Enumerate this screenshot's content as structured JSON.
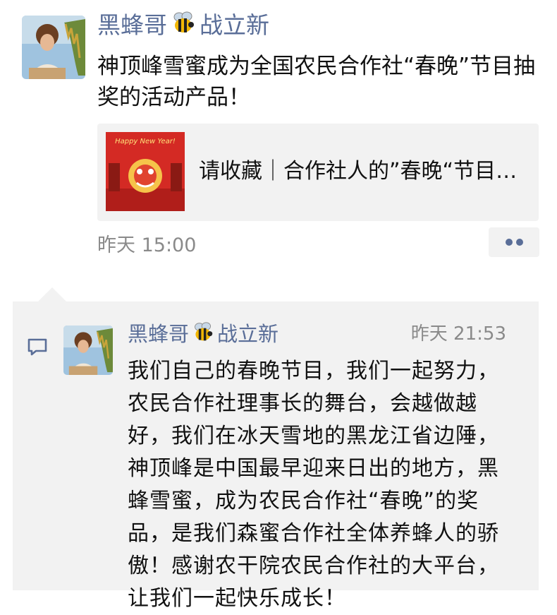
{
  "post": {
    "author": {
      "name": "黑蜂哥",
      "name_suffix": "战立新",
      "avatar_icon": "avatar-photo",
      "emoji_icon": "bee-icon"
    },
    "text": "神顶峰雪蜜成为全国农民合作社“春晚”节目抽奖的活动产品！",
    "shared_link": {
      "title": "请收藏｜合作社人的”春晚“节目…",
      "thumb_text": "Happy New Year!",
      "thumb_icon": "lion-dance-icon"
    },
    "time": "昨天 15:00",
    "more_icon": "more-dots-icon"
  },
  "comments": [
    {
      "name": "黑蜂哥",
      "name_suffix": "战立新",
      "time": "昨天 21:53",
      "text": "我们自己的春晚节目，我们一起努力，农民合作社理事长的舞台，会越做越好，我们在冰天雪地的黑龙江省边陲，神顶峰是中国最早迎来日出的地方，黑蜂雪蜜，成为农民合作社“春晚”的奖品，是我们森蜜合作社全体养蜂人的骄傲！感谢农干院农民合作社的大平台，让我们一起快乐成长！"
    }
  ],
  "colors": {
    "name_blue": "#5a6e98",
    "time_gray": "#8a8a8a",
    "card_bg": "#f2f2f2",
    "thumb_red": "#d42a24"
  }
}
